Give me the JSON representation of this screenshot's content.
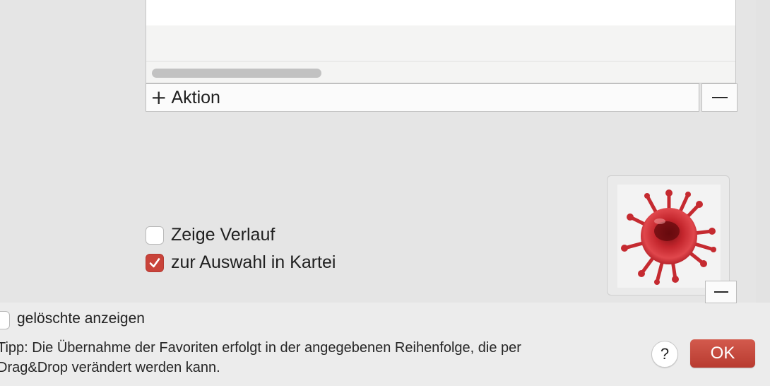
{
  "actions": {
    "add_plus": "+",
    "add_label": "Aktion",
    "remove_icon": "minus-icon"
  },
  "options": {
    "show_history_label": "Zeige Verlauf",
    "show_history_checked": false,
    "select_in_index_label": "zur Auswahl in Kartei",
    "select_in_index_checked": true
  },
  "image_well": {
    "image_icon": "virus-icon",
    "remove_icon": "minus-icon"
  },
  "footer": {
    "show_deleted_label": "gelöschte anzeigen",
    "show_deleted_checked": false,
    "tip_line1": "Tipp: Die Übernahme der Favoriten erfolgt in der angegebenen Reihenfolge, die per",
    "tip_line2": "Drag&Drop verändert werden kann.",
    "help_label": "?",
    "ok_label": "OK"
  },
  "colors": {
    "accent": "#c9433a",
    "ok_button": "#c2463a",
    "background": "#e3e3e3"
  }
}
